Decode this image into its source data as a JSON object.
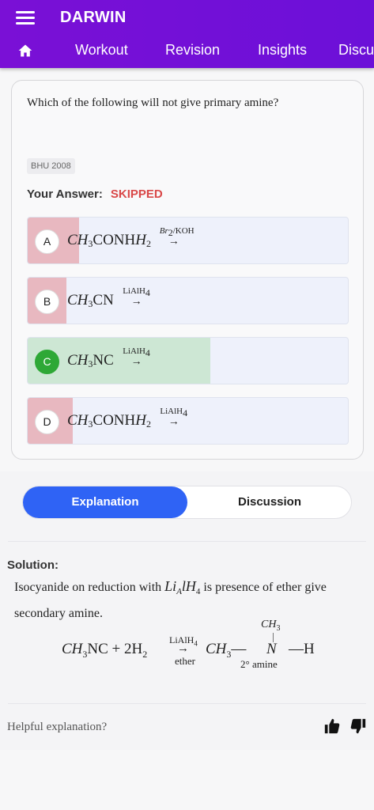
{
  "app": {
    "title": "DARWIN"
  },
  "nav": {
    "home_icon": "home-icon",
    "tabs": [
      "Workout",
      "Revision",
      "Insights",
      "Discu"
    ]
  },
  "question": {
    "text": "Which of the following will not give primary amine?",
    "source": "BHU 2008",
    "answer_label": "Your Answer:",
    "answer_status": "SKIPPED"
  },
  "options": [
    {
      "letter": "A",
      "state": "wrong",
      "fill_fraction": 0.16,
      "reactant": "CH",
      "s1": "3",
      "mid": "CONH",
      "s2": "2",
      "reagent": "Br",
      "reagent_sub": "2",
      "reagent_rest": "/KOH"
    },
    {
      "letter": "B",
      "state": "wrong",
      "fill_fraction": 0.12,
      "reactant": "CH",
      "s1": "3",
      "mid": "CN",
      "reagent": "LiAlH",
      "reagent_sub": "4"
    },
    {
      "letter": "C",
      "state": "correct",
      "fill_fraction": 0.57,
      "reactant": "CH",
      "s1": "3",
      "mid": "NC",
      "reagent": "LiAlH",
      "reagent_sub": "4"
    },
    {
      "letter": "D",
      "state": "wrong",
      "fill_fraction": 0.14,
      "reactant": "CH",
      "s1": "3",
      "mid": "CONH",
      "s2": "2",
      "reagent": "LiAlH",
      "reagent_sub": "4"
    }
  ],
  "toggle": {
    "active": "Explanation",
    "inactive": "Discussion"
  },
  "solution": {
    "label": "Solution:",
    "text_pre": "Isocyanide on reduction with",
    "text_formula": "Li",
    "text_formula_sub": "A",
    "text_formula_rest": "lH",
    "text_formula_sub2": "4",
    "text_post": "is presence of ether give secondary amine.",
    "equation": {
      "lhs": "CH",
      "lhs_sub": "3",
      "lhs_mid": "NC + 2H",
      "lhs_sub2": "2",
      "reagent": "LiAlH",
      "reagent_sub": "4",
      "condition": "ether",
      "product": "CH",
      "product_sub": "3",
      "branch_top": "CH",
      "branch_top_sub": "3",
      "center": "N",
      "tail": "—H",
      "center_label": "2° amine"
    }
  },
  "feedback": {
    "prompt": "Helpful explanation?",
    "up_icon": "thumbs-up-icon",
    "down_icon": "thumbs-down-icon"
  },
  "colors": {
    "brand": "#7a10d6",
    "accent": "#2f63f5",
    "wrong": "#e8b8c0",
    "correct": "#2ea836",
    "skipped": "#d94848"
  }
}
